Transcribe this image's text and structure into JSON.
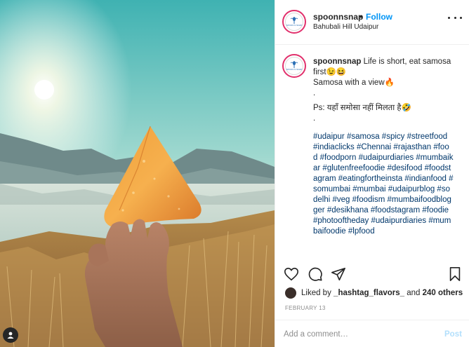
{
  "post": {
    "username": "spoonnsnap",
    "separator": "•",
    "follow_label": "Follow",
    "location": "Bahubali Hill Udaipur",
    "avatar_watermark": "SPOON N SNAP"
  },
  "caption": {
    "username": "spoonnsnap",
    "lines": [
      "Life is short, eat samosa first😉😆",
      "Samosa with a view🔥",
      ".",
      "Ps: यहाँ समोसा नहीं मिलता है🤣",
      "."
    ],
    "hashtags": "#udaipur #samosa #spicy #streetfood #indiaclicks #Chennai #rajasthan #food #foodporn #udaipurdiaries #mumbaikar #glutenfreefoodie #desifood #foodstagram #eatingfortheinsta #indianfood #somumbai #mumbai #udaipurblog  #sodelhi #veg #foodism #mumbaifoodblogger #desikhana #foodstagram #foodie #photooftheday #udaipurdiaries  #mumbaifoodie #lpfood"
  },
  "likes": {
    "prefix": "Liked by",
    "user": "_hashtag_flavors_",
    "connector": "and",
    "others": "240 others"
  },
  "date": "FEBRUARY 13",
  "comment_box": {
    "placeholder": "Add a comment…",
    "post_label": "Post"
  },
  "icons": {
    "like": "heart-icon",
    "comment": "comment-icon",
    "share": "share-icon",
    "save": "bookmark-icon",
    "more": "more-options-icon",
    "tagged": "user-tag-icon"
  },
  "colors": {
    "link": "#0095f6",
    "hashtag": "#00376b",
    "muted": "#8e8e8e",
    "post_disabled": "#b2dffc"
  }
}
